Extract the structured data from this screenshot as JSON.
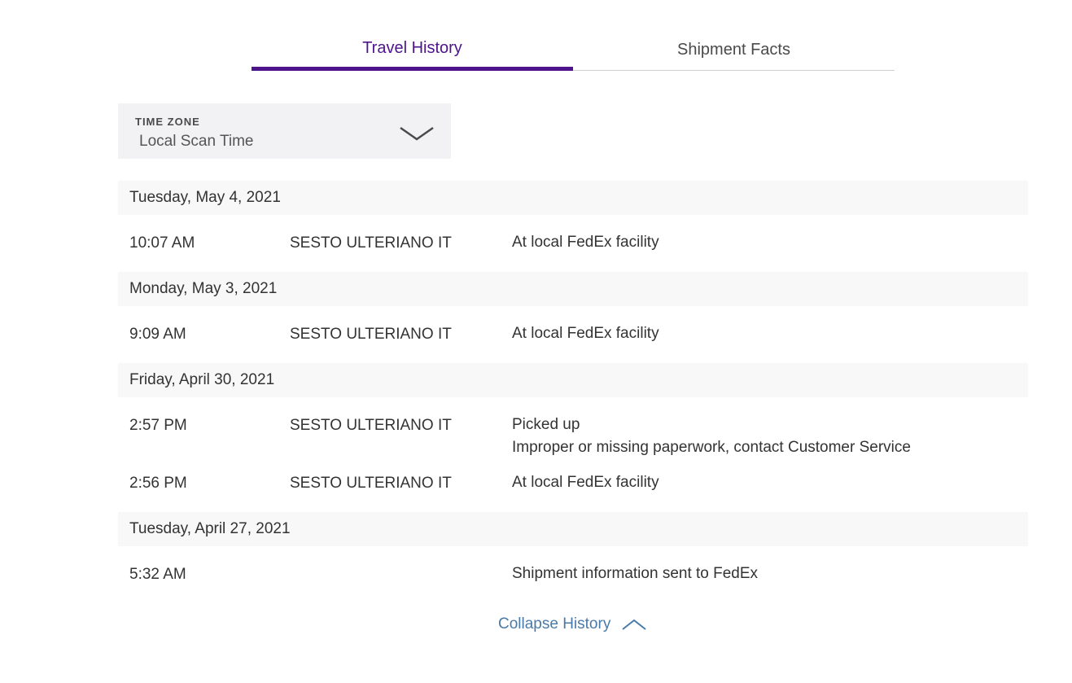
{
  "tabs": [
    {
      "label": "Travel History",
      "active": true
    },
    {
      "label": "Shipment Facts",
      "active": false
    }
  ],
  "timezone": {
    "label": "TIME ZONE",
    "value": "Local Scan Time"
  },
  "history": [
    {
      "date": "Tuesday, May 4, 2021",
      "events": [
        {
          "time": "10:07 AM",
          "location": "SESTO ULTERIANO IT",
          "description": [
            "At local FedEx facility"
          ]
        }
      ]
    },
    {
      "date": "Monday, May 3, 2021",
      "events": [
        {
          "time": "9:09 AM",
          "location": "SESTO ULTERIANO IT",
          "description": [
            "At local FedEx facility"
          ]
        }
      ]
    },
    {
      "date": "Friday, April 30, 2021",
      "events": [
        {
          "time": "2:57 PM",
          "location": "SESTO ULTERIANO IT",
          "description": [
            "Picked up",
            "Improper or missing paperwork, contact Customer Service"
          ]
        },
        {
          "time": "2:56 PM",
          "location": "SESTO ULTERIANO IT",
          "description": [
            "At local FedEx facility"
          ]
        }
      ]
    },
    {
      "date": "Tuesday, April 27, 2021",
      "events": [
        {
          "time": "5:32 AM",
          "location": "",
          "description": [
            "Shipment information sent to FedEx"
          ]
        }
      ]
    }
  ],
  "collapse": {
    "label": "Collapse History",
    "icon": "chevron-up-icon"
  },
  "colors": {
    "accent": "#4d148c",
    "link": "#4a7aa8"
  }
}
